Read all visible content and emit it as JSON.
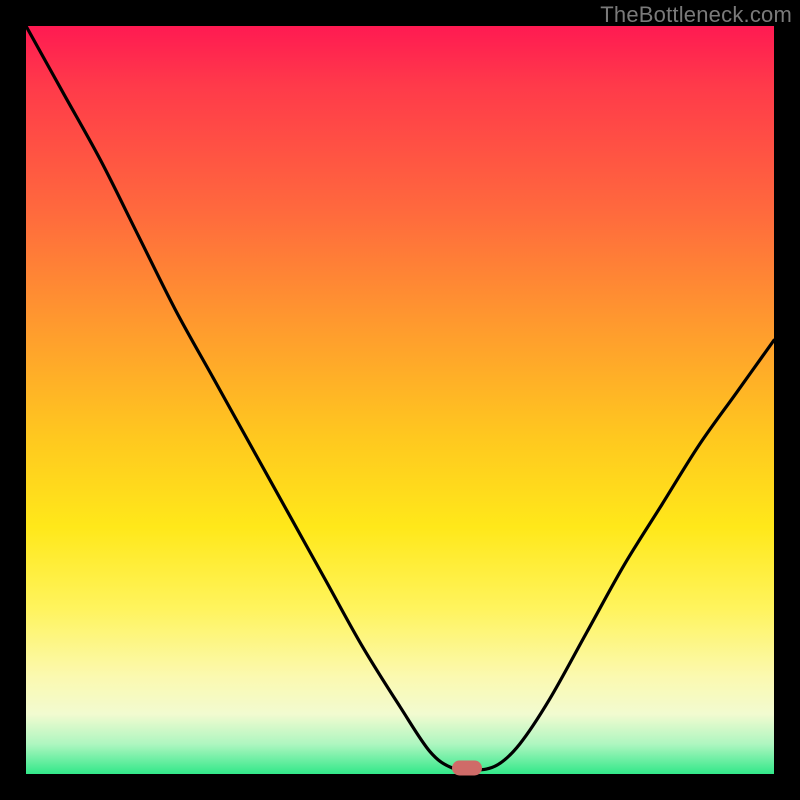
{
  "attribution": "TheBottleneck.com",
  "gradient_colors": {
    "top": "#ff1a52",
    "mid1": "#ff9a2e",
    "mid2": "#ffe81a",
    "bottom": "#32e889"
  },
  "marker": {
    "x_frac": 0.59,
    "y_frac": 0.992,
    "color": "#cf6b68"
  },
  "chart_data": {
    "type": "line",
    "title": "",
    "xlabel": "",
    "ylabel": "",
    "xlim": [
      0,
      1
    ],
    "ylim": [
      0,
      1
    ],
    "grid": false,
    "legend": false,
    "series": [
      {
        "name": "bottleneck-curve",
        "x": [
          0.0,
          0.05,
          0.1,
          0.15,
          0.2,
          0.25,
          0.3,
          0.35,
          0.4,
          0.45,
          0.5,
          0.54,
          0.57,
          0.6,
          0.63,
          0.66,
          0.7,
          0.75,
          0.8,
          0.85,
          0.9,
          0.95,
          1.0
        ],
        "y": [
          1.0,
          0.91,
          0.82,
          0.72,
          0.62,
          0.53,
          0.44,
          0.35,
          0.26,
          0.17,
          0.09,
          0.03,
          0.008,
          0.005,
          0.012,
          0.04,
          0.1,
          0.19,
          0.28,
          0.36,
          0.44,
          0.51,
          0.58
        ]
      }
    ],
    "annotations": [
      {
        "label": "optimum-marker",
        "x": 0.59,
        "y": 0.005
      }
    ]
  }
}
